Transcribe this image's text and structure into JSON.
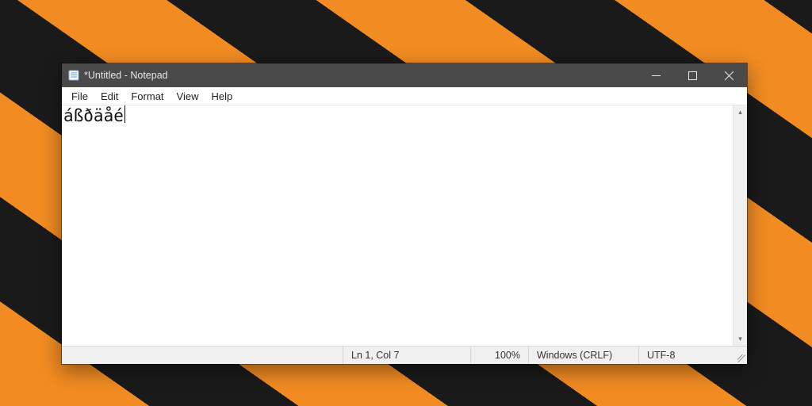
{
  "window": {
    "title": "*Untitled - Notepad"
  },
  "menu": {
    "file": "File",
    "edit": "Edit",
    "format": "Format",
    "view": "View",
    "help": "Help"
  },
  "document": {
    "content": "áßðäåé"
  },
  "status": {
    "position": "Ln 1, Col 7",
    "zoom": "100%",
    "eol": "Windows (CRLF)",
    "encoding": "UTF-8"
  }
}
